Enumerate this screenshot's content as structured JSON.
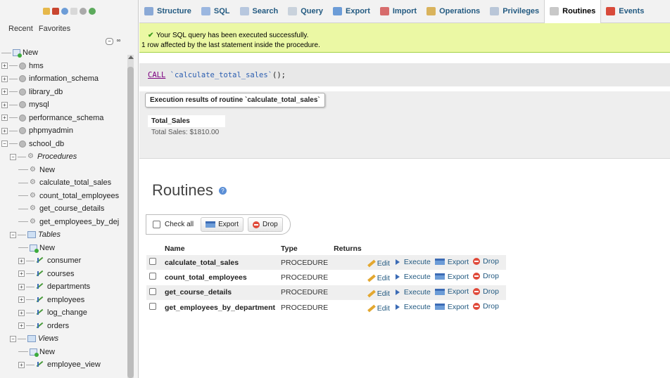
{
  "sidebar": {
    "tabs": [
      "Recent",
      "Favorites"
    ],
    "tree": [
      {
        "label": "New",
        "kind": "new",
        "level": 0
      },
      {
        "label": "hms",
        "kind": "db",
        "level": 0
      },
      {
        "label": "information_schema",
        "kind": "db",
        "level": 0
      },
      {
        "label": "library_db",
        "kind": "db",
        "level": 0
      },
      {
        "label": "mysql",
        "kind": "db",
        "level": 0
      },
      {
        "label": "performance_schema",
        "kind": "db",
        "level": 0
      },
      {
        "label": "phpmyadmin",
        "kind": "db",
        "level": 0
      },
      {
        "label": "school_db",
        "kind": "db-open",
        "level": 0
      },
      {
        "label": "Procedures",
        "kind": "group",
        "level": 1
      },
      {
        "label": "New",
        "kind": "new-proc",
        "level": 2
      },
      {
        "label": "calculate_total_sales",
        "kind": "proc",
        "level": 2
      },
      {
        "label": "count_total_employees",
        "kind": "proc",
        "level": 2
      },
      {
        "label": "get_course_details",
        "kind": "proc",
        "level": 2
      },
      {
        "label": "get_employees_by_dej",
        "kind": "proc",
        "level": 2
      },
      {
        "label": "Tables",
        "kind": "group-tbl",
        "level": 1
      },
      {
        "label": "New",
        "kind": "new",
        "level": 2
      },
      {
        "label": "consumer",
        "kind": "table",
        "level": 2
      },
      {
        "label": "courses",
        "kind": "table",
        "level": 2
      },
      {
        "label": "departments",
        "kind": "table",
        "level": 2
      },
      {
        "label": "employees",
        "kind": "table",
        "level": 2
      },
      {
        "label": "log_change",
        "kind": "table",
        "level": 2
      },
      {
        "label": "orders",
        "kind": "table",
        "level": 2
      },
      {
        "label": "Views",
        "kind": "group-view",
        "level": 1
      },
      {
        "label": "New",
        "kind": "new",
        "level": 2
      },
      {
        "label": "employee_view",
        "kind": "view",
        "level": 2
      }
    ]
  },
  "tabs": [
    {
      "label": "Structure",
      "color": "#8aa9d6"
    },
    {
      "label": "SQL",
      "color": "#9bb7e0"
    },
    {
      "label": "Search",
      "color": "#b7c7de"
    },
    {
      "label": "Query",
      "color": "#c9d2dc"
    },
    {
      "label": "Export",
      "color": "#6c9cd7"
    },
    {
      "label": "Import",
      "color": "#d76c6c"
    },
    {
      "label": "Operations",
      "color": "#d9b35c"
    },
    {
      "label": "Privileges",
      "color": "#b9c6d8"
    },
    {
      "label": "Routines",
      "color": "#c8c8c8",
      "active": true
    },
    {
      "label": "Events",
      "color": "#d84a3a"
    }
  ],
  "message": {
    "line1": "Your SQL query has been executed successfully.",
    "line2": "1 row affected by the last statement inside the procedure."
  },
  "sql": {
    "keyword": "CALL",
    "routine": "`calculate_total_sales`",
    "tail": "();"
  },
  "results": {
    "legend": "Execution results of routine `calculate_total_sales`",
    "column": "Total_Sales",
    "value": "Total Sales: $1810.00"
  },
  "routines": {
    "title": "Routines",
    "check_all": "Check all",
    "export": "Export",
    "drop": "Drop",
    "headers": [
      "Name",
      "Type",
      "Returns"
    ],
    "actions": [
      "Edit",
      "Execute",
      "Export",
      "Drop"
    ],
    "rows": [
      {
        "name": "calculate_total_sales",
        "type": "PROCEDURE",
        "returns": ""
      },
      {
        "name": "count_total_employees",
        "type": "PROCEDURE",
        "returns": ""
      },
      {
        "name": "get_course_details",
        "type": "PROCEDURE",
        "returns": ""
      },
      {
        "name": "get_employees_by_department",
        "type": "PROCEDURE",
        "returns": ""
      }
    ]
  }
}
